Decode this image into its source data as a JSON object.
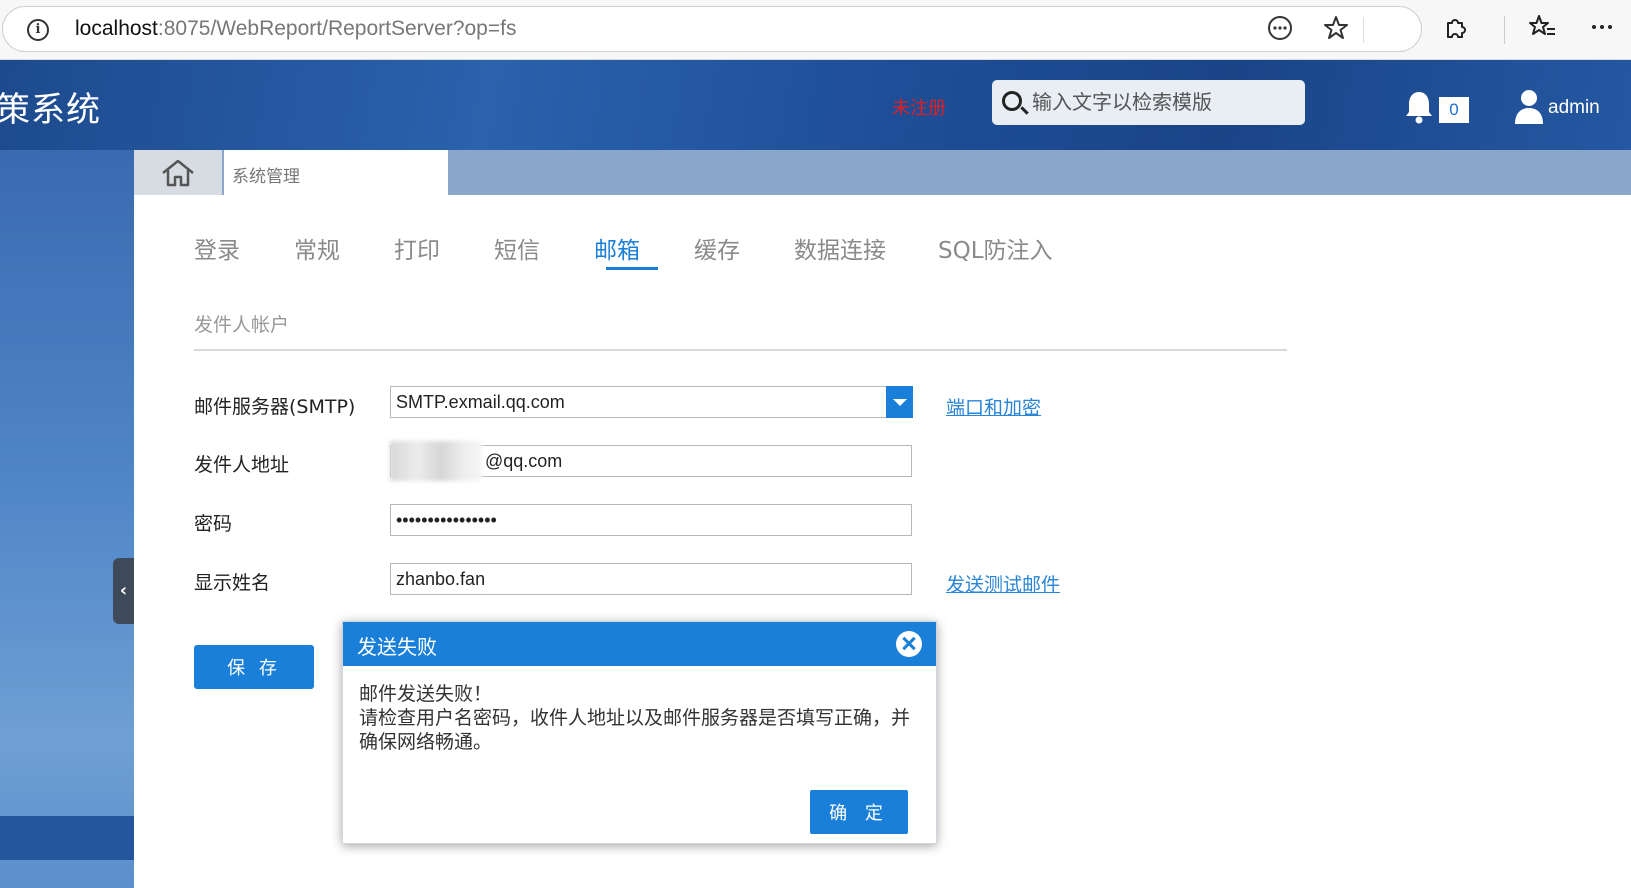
{
  "browser": {
    "url_host": "localhost",
    "url_rest": ":8075/WebReport/ReportServer?op=fs",
    "icons": [
      "info-icon",
      "more-options-icon",
      "favorite-star-icon",
      "extensions-icon",
      "favorites-list-icon",
      "browser-menu-icon"
    ]
  },
  "header": {
    "app_title": "策系统",
    "unregistered": "未注册",
    "search_placeholder": "输入文字以检索模版",
    "notification_count": "0",
    "user_name": "admin"
  },
  "tabstrip": {
    "current_tab": "系统管理"
  },
  "nav": {
    "tabs": [
      "登录",
      "常规",
      "打印",
      "短信",
      "邮箱",
      "缓存",
      "数据连接",
      "SQL防注入"
    ],
    "active_tab": "邮箱"
  },
  "form": {
    "section_title": "发件人帐户",
    "smtp_label": "邮件服务器(SMTP)",
    "smtp_value": "SMTP.exmail.qq.com",
    "port_link": "端口和加密",
    "sender_label": "发件人地址",
    "sender_value": "@qq.com",
    "password_label": "密码",
    "password_value": "••••••••••••••••",
    "display_name_label": "显示姓名",
    "display_name_value": "zhanbo.fan",
    "test_mail_link": "发送测试邮件",
    "save_label": "保 存"
  },
  "dialog": {
    "title": "发送失败",
    "line1": "邮件发送失败！",
    "line2": "请检查用户名密码，收件人地址以及邮件服务器是否填写正确，并确保网络畅通。",
    "ok_label": "确 定"
  },
  "colors": {
    "accent": "#1a7fd8",
    "header_bg": "#1e4e97",
    "unregistered": "#e02020"
  }
}
